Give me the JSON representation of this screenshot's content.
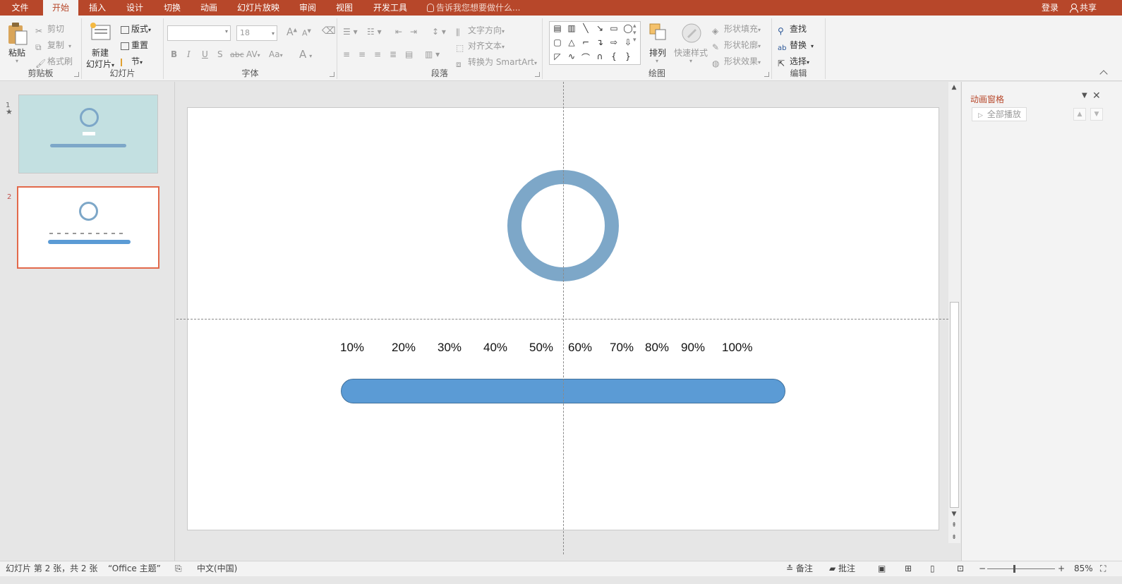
{
  "colors": {
    "title_bar": "#b7472a",
    "ribbon": "#f3f3f3",
    "ring": "#7da7c8",
    "bar_fill": "#5b9bd5",
    "thumb1_bg": "#c3e0e1",
    "thumb_selected_border": "#e2694b"
  },
  "menubar": {
    "tabs": [
      "文件",
      "开始",
      "插入",
      "设计",
      "切换",
      "动画",
      "幻灯片放映",
      "审阅",
      "视图",
      "开发工具"
    ],
    "active_tab": "开始",
    "tellme": "告诉我您想要做什么...",
    "login": "登录",
    "share": "共享"
  },
  "ribbon": {
    "clipboard": {
      "label": "剪贴板",
      "paste": "粘贴",
      "cut": "剪切",
      "copy": "复制",
      "format_painter": "格式刷"
    },
    "slides": {
      "label": "幻灯片",
      "new_slide_line1": "新建",
      "new_slide_line2": "幻灯片",
      "layout": "版式",
      "reset": "重置",
      "section": "节"
    },
    "font": {
      "label": "字体",
      "font_name": "",
      "font_size": "18",
      "bold": "B",
      "italic": "I",
      "underline": "U",
      "shadow": "S",
      "strike": "abc",
      "spacing": "AV",
      "case": "Aa",
      "color": "A",
      "grow": "A",
      "shrink": "A"
    },
    "paragraph": {
      "label": "段落",
      "text_direction": "文字方向",
      "align_text": "对齐文本",
      "smartart": "转换为 SmartArt"
    },
    "drawing": {
      "label": "绘图",
      "arrange": "排列",
      "quick_styles": "快速样式",
      "fill": "形状填充",
      "outline": "形状轮廓",
      "effects": "形状效果"
    },
    "editing": {
      "label": "编辑",
      "find": "查找",
      "replace": "替换",
      "select": "选择"
    }
  },
  "thumbnails": [
    {
      "number": "1",
      "has_star": true,
      "selected": false
    },
    {
      "number": "2",
      "has_star": false,
      "selected": true
    }
  ],
  "slide": {
    "percent_labels": [
      "10%",
      "20%",
      "30%",
      "40%",
      "50%",
      "60%",
      "70%",
      "80%",
      "90%",
      "100%"
    ]
  },
  "animation_pane": {
    "title": "动画窗格",
    "play_all": "全部播放"
  },
  "status": {
    "slide_info": "幻灯片 第 2 张，共 2 张",
    "theme": "“Office 主题”",
    "language": "中文(中国)",
    "notes": "备注",
    "comments": "批注",
    "zoom": "85%"
  }
}
